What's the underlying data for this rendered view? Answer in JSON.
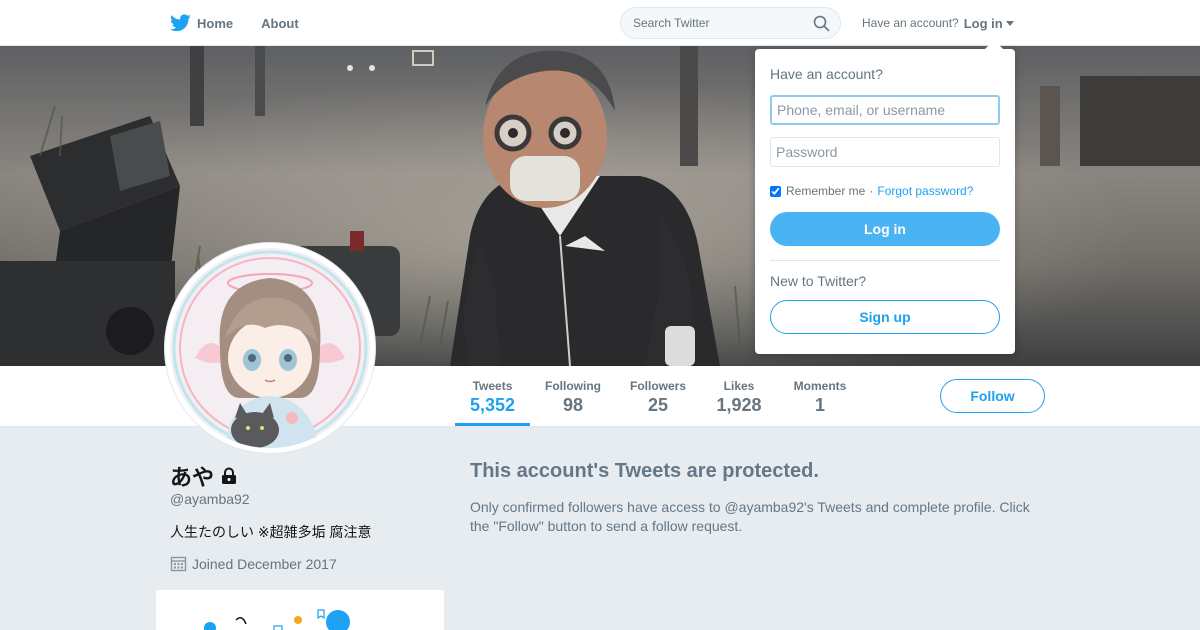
{
  "nav": {
    "home_label": "Home",
    "about_label": "About",
    "search_placeholder": "Search Twitter",
    "have_account": "Have an account?",
    "login_label": "Log in"
  },
  "profile": {
    "name": "あや",
    "handle": "@ayamba92",
    "bio": "人生たのしい ※超雑多垢 腐注意",
    "joined": "Joined December 2017",
    "protected": true
  },
  "stats": [
    {
      "label": "Tweets",
      "value": "5,352",
      "active": true
    },
    {
      "label": "Following",
      "value": "98",
      "active": false
    },
    {
      "label": "Followers",
      "value": "25",
      "active": false
    },
    {
      "label": "Likes",
      "value": "1,928",
      "active": false
    },
    {
      "label": "Moments",
      "value": "1",
      "active": false
    }
  ],
  "follow_label": "Follow",
  "protected_notice": {
    "title": "This account's Tweets are protected.",
    "body": "Only confirmed followers have access to @ayamba92's Tweets and complete profile. Click the \"Follow\" button to send a follow request."
  },
  "login_dropdown": {
    "title": "Have an account?",
    "username_placeholder": "Phone, email, or username",
    "password_placeholder": "Password",
    "remember_label": "Remember me",
    "remember_checked": true,
    "separator": "·",
    "forgot_label": "Forgot password?",
    "login_button": "Log in",
    "new_prompt": "New to Twitter?",
    "signup_button": "Sign up"
  },
  "colors": {
    "accent": "#1da1f2",
    "login_button_bg": "#4ab3f4",
    "page_bg": "#e6ecf0",
    "muted_text": "#657786"
  },
  "icons": {
    "logo": "twitter-bird-icon",
    "search": "search-icon",
    "lock": "lock-icon",
    "calendar": "calendar-icon"
  }
}
